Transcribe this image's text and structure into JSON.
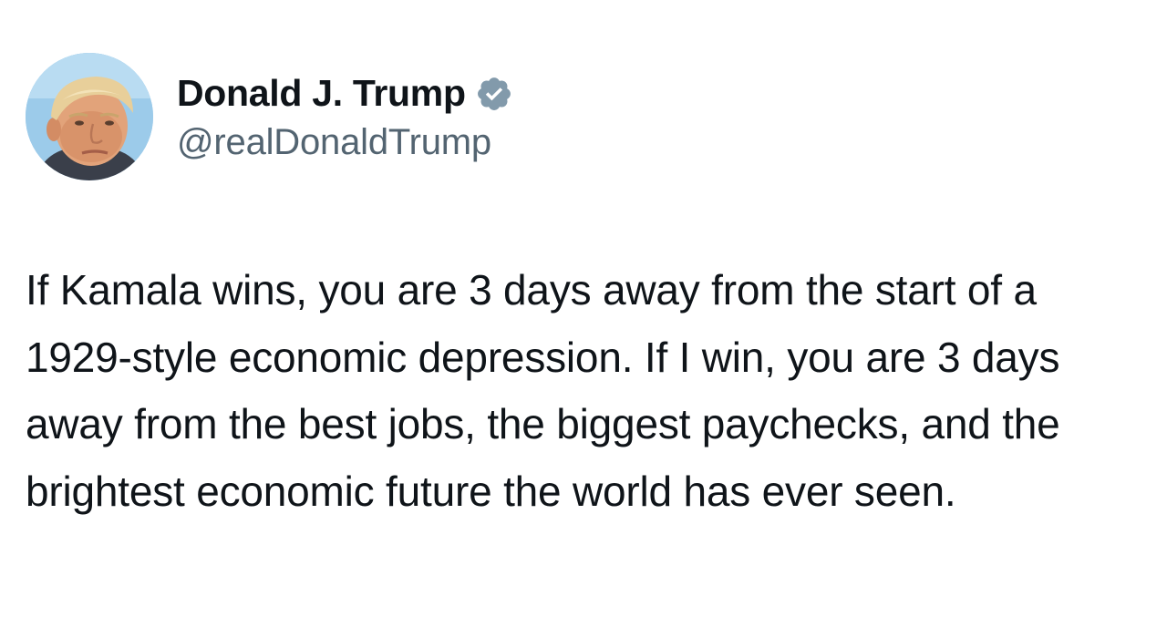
{
  "tweet": {
    "author": {
      "display_name": "Donald J. Trump",
      "handle": "@realDonaldTrump",
      "verified_icon": "verified-badge-icon",
      "verified_color": "#829aab",
      "avatar": "profile-photo"
    },
    "text": "If Kamala wins, you are 3 days away from the start of a 1929-style economic depression. If I win, you are 3 days away from the best jobs, the biggest paychecks, and the brightest economic future the world has ever seen."
  }
}
